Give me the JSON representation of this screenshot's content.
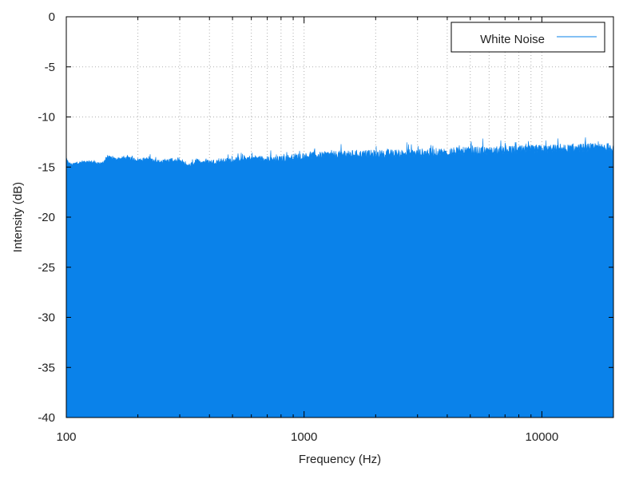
{
  "chart_data": {
    "type": "area",
    "title": "",
    "xlabel": "Frequency (Hz)",
    "ylabel": "Intensity (dB)",
    "x_scale": "log",
    "xlim": [
      100,
      20000
    ],
    "ylim": [
      -40,
      0
    ],
    "x_ticks": [
      100,
      1000,
      10000
    ],
    "x_tick_labels": [
      "100",
      "1000",
      "10000"
    ],
    "y_ticks": [
      0,
      -5,
      -10,
      -15,
      -20,
      -25,
      -30,
      -35,
      -40
    ],
    "y_tick_labels": [
      "0",
      "-5",
      "-10",
      "-15",
      "-20",
      "-25",
      "-30",
      "-35",
      "-40"
    ],
    "grid": true,
    "legend": {
      "position": "top-right"
    },
    "series": [
      {
        "name": "White Noise",
        "color": "#0a82ea",
        "x": [
          100,
          105,
          110,
          120,
          130,
          140,
          150,
          160,
          180,
          200,
          220,
          250,
          280,
          300,
          330,
          350,
          400,
          450,
          500,
          600,
          700,
          800,
          900,
          1000,
          1200,
          1500,
          2000,
          3000,
          4000,
          5000,
          6000,
          8000,
          10000,
          12000,
          15000,
          17000,
          20000
        ],
        "y": [
          -14.3,
          -14.8,
          -14.6,
          -14.5,
          -14.5,
          -14.7,
          -14.0,
          -14.2,
          -14.1,
          -14.3,
          -14.2,
          -14.5,
          -14.3,
          -14.5,
          -14.9,
          -14.4,
          -14.5,
          -14.4,
          -14.3,
          -14.1,
          -14.2,
          -14.2,
          -14.0,
          -13.9,
          -13.8,
          -13.7,
          -13.7,
          -13.6,
          -13.5,
          -13.4,
          -13.4,
          -13.3,
          -13.2,
          -13.2,
          -13.1,
          -13.1,
          -13.0
        ]
      }
    ]
  }
}
